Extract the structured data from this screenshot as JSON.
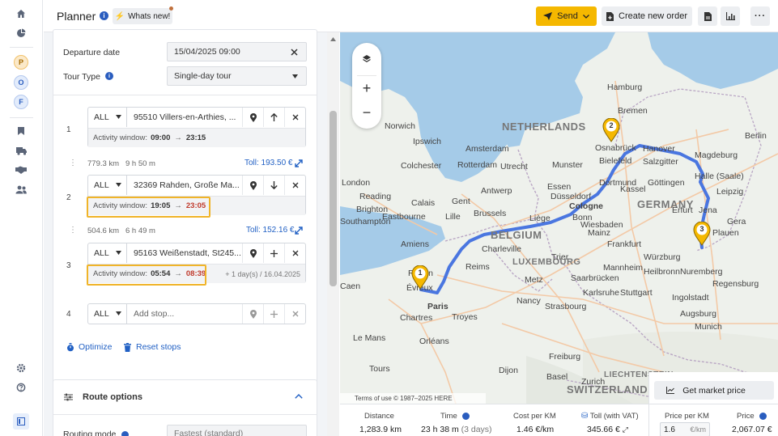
{
  "header": {
    "title": "Planner",
    "whats_new": "Whats new!",
    "send": "Send",
    "create_order": "Create new order"
  },
  "rail": {
    "avatars": [
      "P",
      "O",
      "F"
    ]
  },
  "form": {
    "departure_label": "Departure date",
    "departure_value": "15/04/2025 09:00",
    "tour_type_label": "Tour Type",
    "tour_type_value": "Single-day tour"
  },
  "stops": [
    {
      "num": "1",
      "filter": "ALL",
      "address": "95510 Villers-en-Arthies, ...",
      "window_label": "Activity window:",
      "from": "09:00",
      "to": "23:15",
      "extra": ""
    },
    {
      "num": "2",
      "filter": "ALL",
      "address": "32369 Rahden, Große Ma...",
      "window_label": "Activity window:",
      "from": "19:05",
      "to": "23:05",
      "extra": ""
    },
    {
      "num": "3",
      "filter": "ALL",
      "address": "95163 Weißenstadt, St245...",
      "window_label": "Activity window:",
      "from": "05:54",
      "to": "08:39",
      "extra": "+ 1 day(s) / 16.04.2025"
    },
    {
      "num": "4",
      "filter": "ALL",
      "placeholder": "Add stop..."
    }
  ],
  "legs": [
    {
      "distance": "779.3 km",
      "duration": "9 h 50 m",
      "toll": "Toll: 193.50 €"
    },
    {
      "distance": "504.6 km",
      "duration": "6 h 49 m",
      "toll": "Toll: 152.16 €"
    }
  ],
  "actions": {
    "optimize": "Optimize",
    "reset": "Reset stops"
  },
  "route_options": {
    "title": "Route options",
    "routing_mode_label": "Routing mode",
    "routing_mode_value": "Fastest (standard)"
  },
  "map": {
    "countries": [
      "NETHERLANDS",
      "BELGIUM",
      "GERMANY",
      "LUXEMBOURG",
      "LIECHTENSTEIN",
      "SWITZERLAND"
    ],
    "cities": [
      "Hamburg",
      "Bremen",
      "Berlin",
      "Amsterdam",
      "Rotterdam",
      "Utrecht",
      "Osnabrück",
      "Hanover",
      "Magdeburg",
      "London",
      "Colchester",
      "Ipswich",
      "Norwich",
      "Munster",
      "Bielefeld",
      "Salzgitter",
      "Halle (Saale)",
      "Leipzig",
      "Dortmund",
      "Essen",
      "Düsseldorf",
      "Cologne",
      "Bonn",
      "Kassel",
      "Göttingen",
      "Gent",
      "Brussels",
      "Antwerp",
      "Liège",
      "Lille",
      "Calais",
      "Brighton",
      "Southampton",
      "Reading",
      "Eastbourne",
      "Erfurt",
      "Jena",
      "Plauen",
      "Frankfurt",
      "Wiesbaden",
      "Mainz",
      "Würzburg",
      "Nuremberg",
      "Mannheim",
      "Heilbronn",
      "Stuttgart",
      "Augsburg",
      "Munich",
      "Strasbourg",
      "Freiburg",
      "Metz",
      "Nancy",
      "Reims",
      "Troyes",
      "Paris",
      "Évreux",
      "Rouen",
      "Caen",
      "Le Mans",
      "Orléans",
      "Tours",
      "Dijon",
      "Basel",
      "Zurich",
      "Chartres",
      "Saarbrücken",
      "Trier",
      "Amiens",
      "Charleville",
      "Ingolstadt",
      "Regensburg",
      "Karlsruhe",
      "Gera"
    ],
    "markers": [
      "1",
      "2",
      "3"
    ],
    "attribution": "Terms of use   © 1987–2025 HERE",
    "market_price_btn": "Get market price"
  },
  "stats": {
    "distance_label": "Distance",
    "distance_value": "1,283.9 km",
    "time_label": "Time",
    "time_value": "23 h 38 m",
    "time_days": "(3 days)",
    "cost_label": "Cost per KM",
    "cost_value": "1.46 €/km",
    "toll_label": "Toll (with VAT)",
    "toll_value": "345.66 €",
    "ppk_label": "Price per KM",
    "ppk_value": "1.6",
    "ppk_unit": "€/km",
    "price_label": "Price",
    "price_value": "2,067.07 €"
  },
  "colors": {
    "accent_yellow": "#f5b800",
    "route_blue": "#4a76e0",
    "highlight": "#f0b429",
    "link": "#2160c4"
  }
}
